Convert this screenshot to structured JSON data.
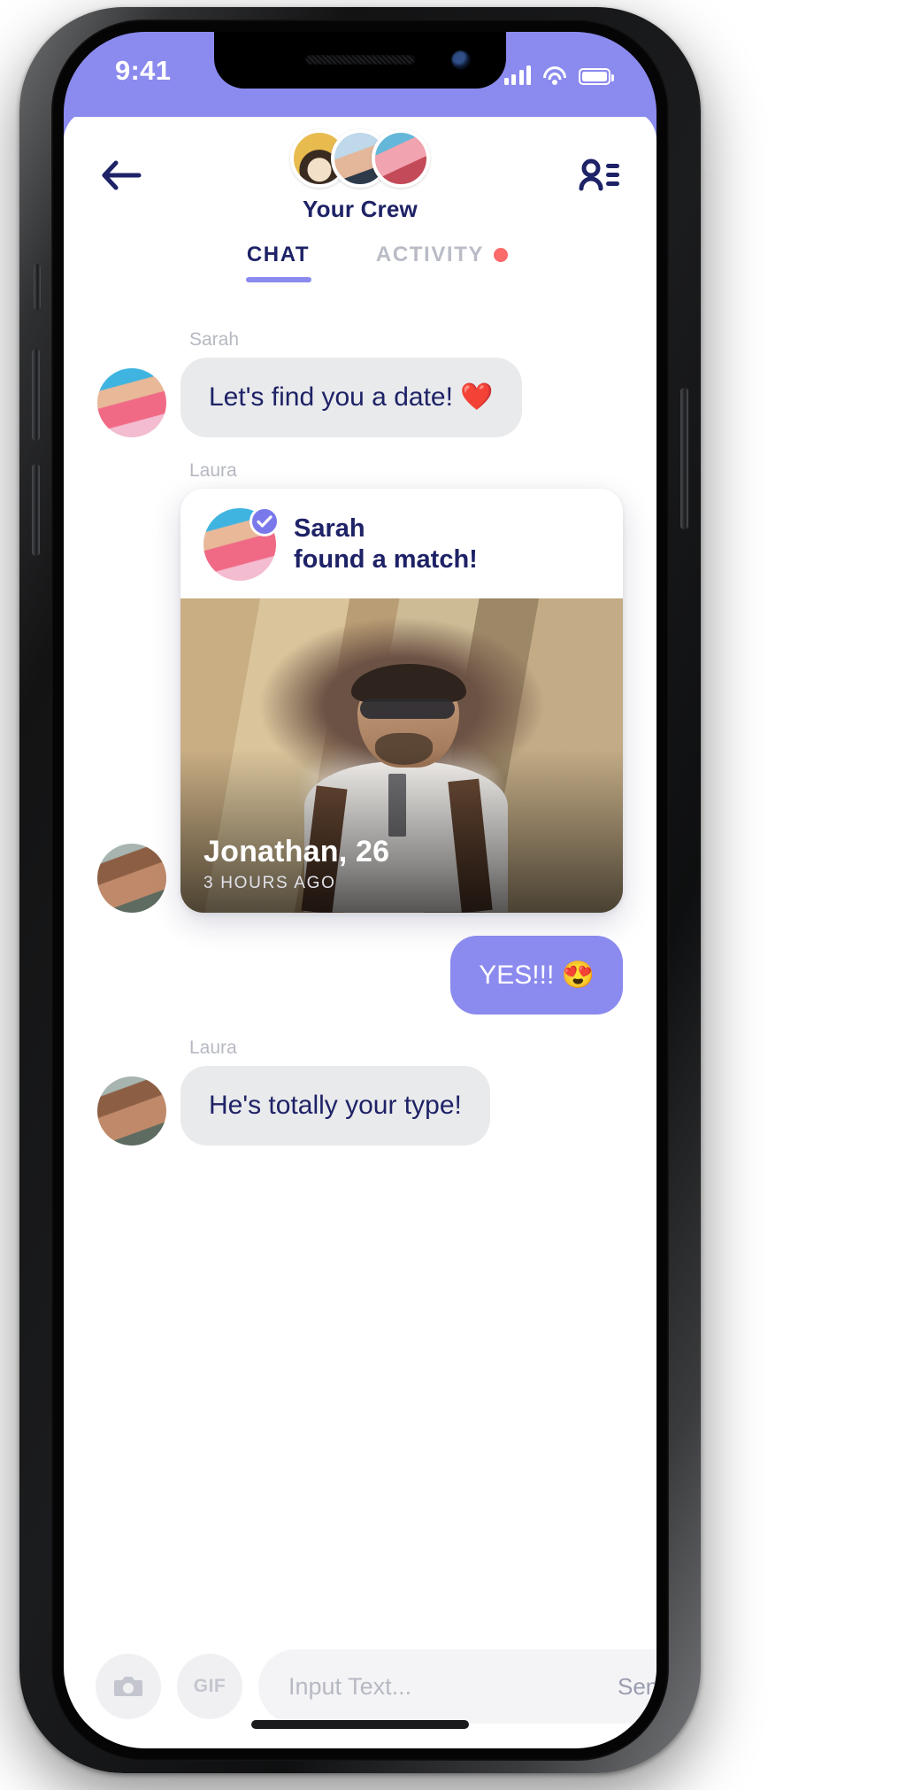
{
  "status_bar": {
    "time": "9:41",
    "signal_icon": "signal-bars-icon",
    "wifi_icon": "wifi-icon",
    "battery_icon": "battery-icon",
    "background_color": "#8b8aee"
  },
  "header": {
    "back_icon": "back-arrow-icon",
    "title": "Your Crew",
    "members_icon": "person-list-icon",
    "crew_avatars": [
      "avatar-crew-1",
      "avatar-crew-2",
      "avatar-crew-3"
    ]
  },
  "tabs": [
    {
      "label": "CHAT",
      "active": true
    },
    {
      "label": "ACTIVITY",
      "active": false,
      "has_notification_dot": true,
      "dot_color": "#fc6a6a"
    }
  ],
  "messages": [
    {
      "type": "text",
      "sender": "Sarah",
      "side": "them",
      "text": "Let's find you a date! ❤️"
    },
    {
      "type": "match_card",
      "sender": "Laura",
      "side": "them",
      "card": {
        "header_line1": "Sarah",
        "header_line2": "found a match!",
        "verified_icon": "check-badge-icon",
        "match_name": "Jonathan, 26",
        "timestamp": "3 HOURS AGO"
      }
    },
    {
      "type": "text",
      "sender": "",
      "side": "me",
      "text": "YES!!! 😍"
    },
    {
      "type": "text",
      "sender": "Laura",
      "side": "them",
      "text": "He's totally your type!"
    }
  ],
  "composer": {
    "camera_icon": "camera-icon",
    "gif_label": "GIF",
    "input_value": "",
    "input_placeholder": "Input Text...",
    "send_label": "Send"
  },
  "theme": {
    "accent": "#8b8aee",
    "text_dark": "#1e2266",
    "bubble_them": "#e9eaec",
    "muted": "#b6b9c2"
  }
}
